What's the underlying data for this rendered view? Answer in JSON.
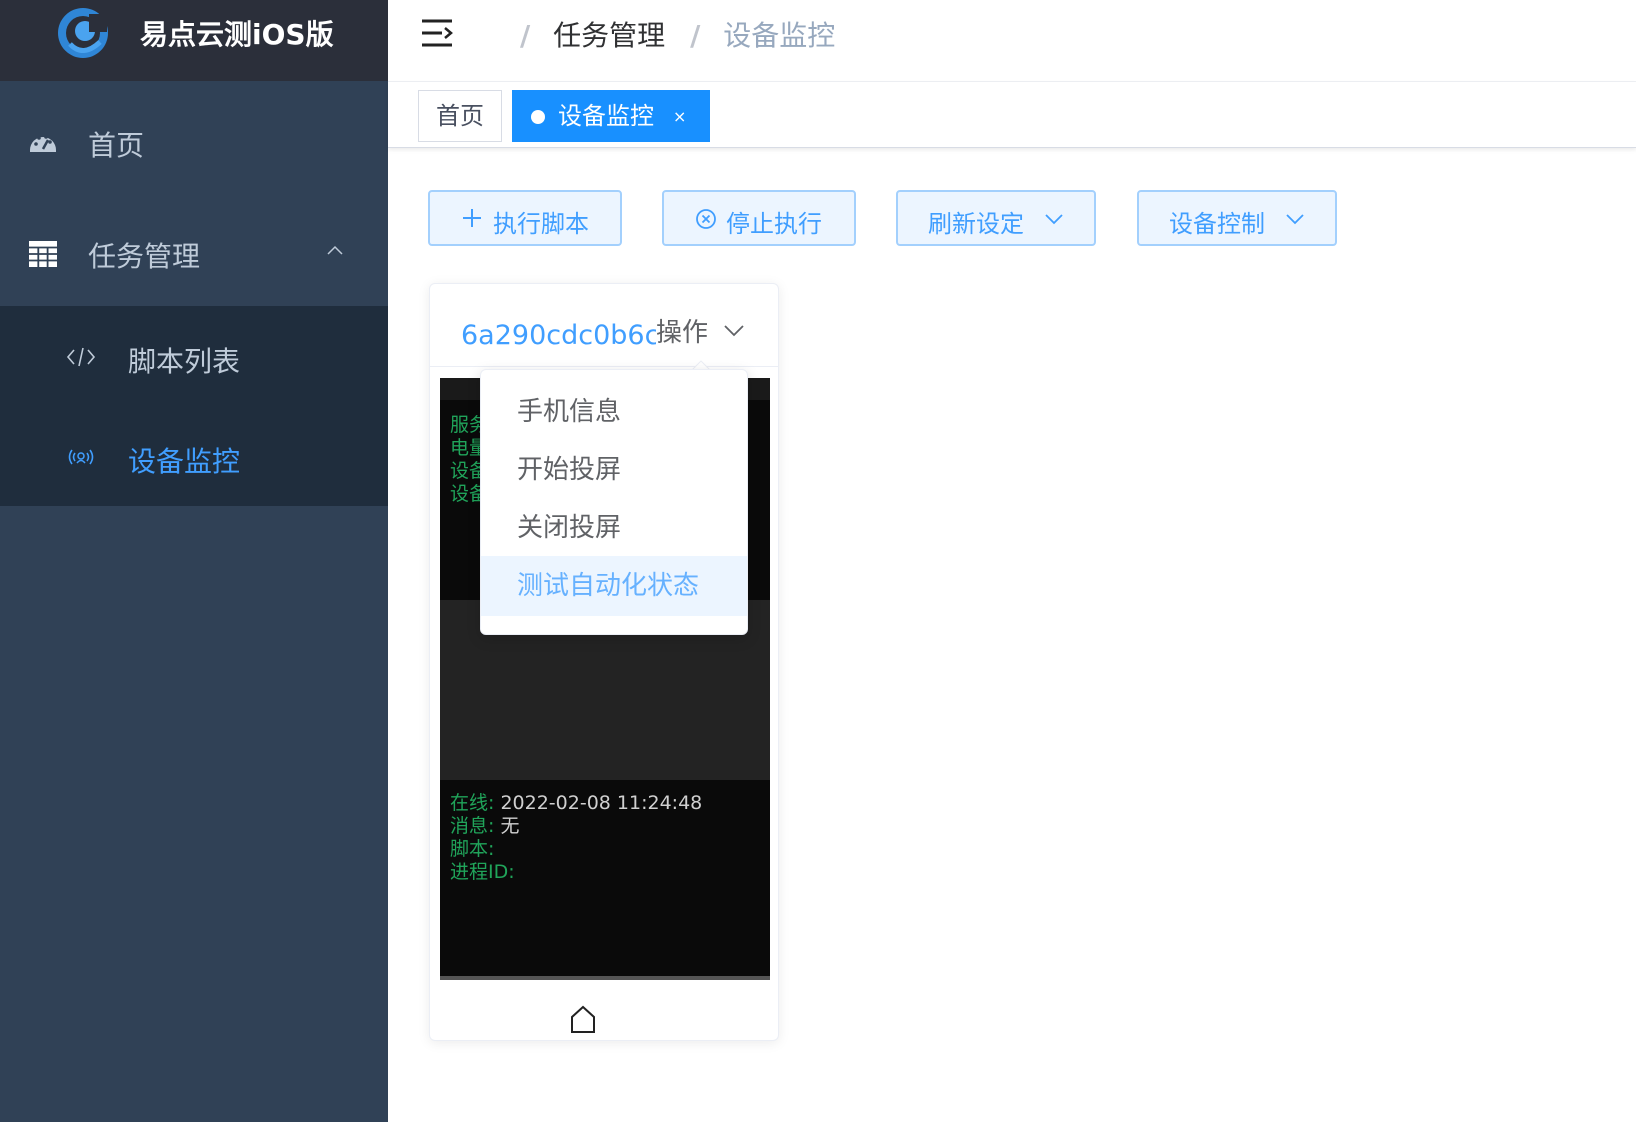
{
  "app": {
    "title": "易点云测iOS版"
  },
  "sidebar": {
    "home_label": "首页",
    "task_label": "任务管理",
    "sub_items": [
      {
        "label": "脚本列表"
      },
      {
        "label": "设备监控",
        "active": true
      }
    ]
  },
  "breadcrumb": {
    "separator": "/",
    "items": [
      "任务管理",
      "设备监控"
    ]
  },
  "tags": {
    "home": "首页",
    "active": "设备监控",
    "close": "×"
  },
  "toolbar": {
    "exec_label": "执行脚本",
    "stop_label": "停止执行",
    "refresh_label": "刷新设定",
    "control_label": "设备控制"
  },
  "device": {
    "id": "6a290cdc0b6c",
    "op_label": "操作",
    "status_lines": [
      "服务",
      "电量",
      "设备",
      "设备"
    ],
    "info": [
      {
        "key": "在线:",
        "value": "2022-02-08 11:24:48"
      },
      {
        "key": "消息:",
        "value": "无"
      },
      {
        "key": "脚本:",
        "value": ""
      },
      {
        "key": "进程ID:",
        "value": ""
      }
    ]
  },
  "dropdown": {
    "items": [
      "手机信息",
      "开始投屏",
      "关闭投屏",
      "测试自动化状态"
    ],
    "highlighted_index": 3
  },
  "colors": {
    "sidebar_bg": "#304156",
    "submenu_bg": "#1f2d3d",
    "accent": "#409eff",
    "tag_active": "#1890ff",
    "terminal_green": "#20a45a"
  },
  "icons": {
    "logo": "logo-icon",
    "home": "dashboard-icon",
    "task": "table-icon",
    "script": "code-icon",
    "monitor": "broadcast-icon",
    "hamburger": "hamburger-icon",
    "plus": "plus-icon",
    "stop": "circle-close-icon",
    "chevron": "chevron-down-icon",
    "home_button": "house-icon"
  }
}
